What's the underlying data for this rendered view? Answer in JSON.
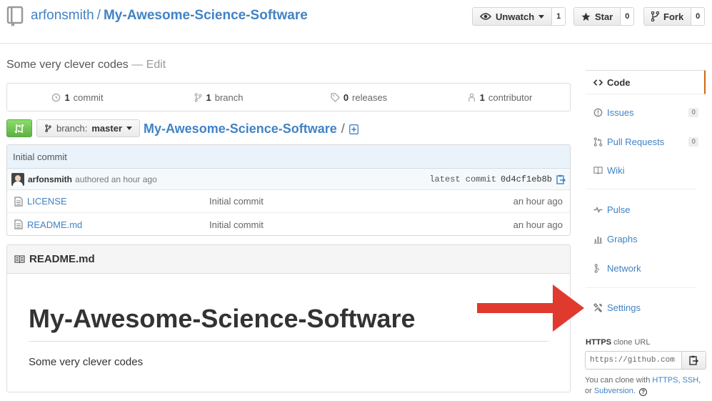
{
  "header": {
    "owner": "arfonsmith",
    "separator": "/",
    "repo_name": "My-Awesome-Science-Software",
    "unwatch_label": "Unwatch",
    "unwatch_count": "1",
    "star_label": "Star",
    "star_count": "0",
    "fork_label": "Fork",
    "fork_count": "0"
  },
  "description": {
    "text": "Some very clever codes",
    "dash": "—",
    "edit_label": "Edit"
  },
  "summary": {
    "commits_count": "1",
    "commits_label": "commit",
    "branches_count": "1",
    "branches_label": "branch",
    "releases_count": "0",
    "releases_label": "releases",
    "contributors_count": "1",
    "contributors_label": "contributor"
  },
  "branch": {
    "label": "branch:",
    "value": "master",
    "breadcrumb_repo": "My-Awesome-Science-Software",
    "breadcrumb_slash": "/"
  },
  "commit": {
    "message": "Initial commit",
    "author": "arfonsmith",
    "authored_text": "authored an hour ago",
    "latest_label": "latest commit",
    "sha": "0d4cf1eb8b"
  },
  "files": [
    {
      "name": "LICENSE",
      "message": "Initial commit",
      "age": "an hour ago"
    },
    {
      "name": "README.md",
      "message": "Initial commit",
      "age": "an hour ago"
    }
  ],
  "readme": {
    "filename": "README.md",
    "heading": "My-Awesome-Science-Software",
    "body": "Some very clever codes"
  },
  "sidebar": {
    "code": "Code",
    "issues": "Issues",
    "issues_count": "0",
    "pull_requests": "Pull Requests",
    "pull_requests_count": "0",
    "wiki": "Wiki",
    "pulse": "Pulse",
    "graphs": "Graphs",
    "network": "Network",
    "settings": "Settings"
  },
  "clone": {
    "protocol": "HTTPS",
    "title_suffix": "clone URL",
    "url": "https://github.com",
    "help_prefix": "You can clone with",
    "https": "HTTPS",
    "comma": ",",
    "ssh": "SSH",
    "or": ", or",
    "subversion": "Subversion",
    "period": "."
  },
  "colors": {
    "link": "#4183c4",
    "arrow": "#e03a2f",
    "compare_green": "#60b044",
    "selected_tab_accent": "#d26911"
  }
}
